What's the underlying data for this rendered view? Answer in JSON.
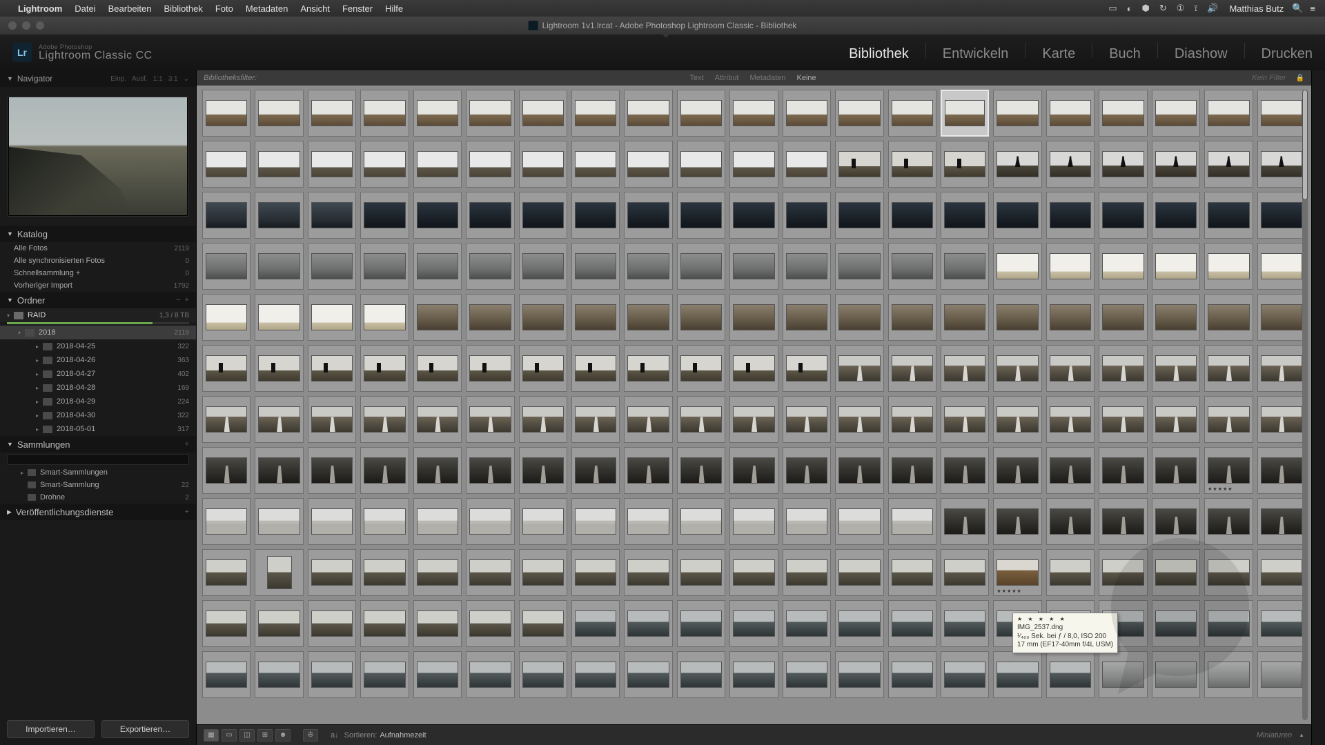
{
  "menubar": {
    "app": "Lightroom",
    "items": [
      "Datei",
      "Bearbeiten",
      "Bibliothek",
      "Foto",
      "Metadaten",
      "Ansicht",
      "Fenster",
      "Hilfe"
    ],
    "user": "Matthias Butz"
  },
  "window": {
    "title": "Lightroom 1v1.lrcat - Adobe Photoshop Lightroom Classic - Bibliothek"
  },
  "brand": {
    "small": "Adobe Photoshop",
    "big": "Lightroom Classic CC",
    "logo": "Lr"
  },
  "modules": {
    "items": [
      "Bibliothek",
      "Entwickeln",
      "Karte",
      "Buch",
      "Diashow",
      "Drucken"
    ],
    "active": 0
  },
  "navigator": {
    "title": "Navigator",
    "fit": "Einp.",
    "fill": "Ausf.",
    "r1": "1:1",
    "r2": "3:1"
  },
  "catalog": {
    "title": "Katalog",
    "rows": [
      {
        "label": "Alle Fotos",
        "count": "2119"
      },
      {
        "label": "Alle synchronisierten Fotos",
        "count": "0"
      },
      {
        "label": "Schnellsammlung  +",
        "count": "0"
      },
      {
        "label": "Vorheriger Import",
        "count": "1792"
      }
    ]
  },
  "folders": {
    "title": "Ordner",
    "volume": {
      "name": "RAID",
      "free": "1,3 / 8 TB"
    },
    "year": {
      "name": "2018",
      "count": "2119"
    },
    "dates": [
      {
        "name": "2018-04-25",
        "count": "322"
      },
      {
        "name": "2018-04-26",
        "count": "363"
      },
      {
        "name": "2018-04-27",
        "count": "402"
      },
      {
        "name": "2018-04-28",
        "count": "169"
      },
      {
        "name": "2018-04-29",
        "count": "224"
      },
      {
        "name": "2018-04-30",
        "count": "322"
      },
      {
        "name": "2018-05-01",
        "count": "317"
      }
    ]
  },
  "collections": {
    "title": "Sammlungen",
    "rows": [
      {
        "label": "Smart-Sammlungen",
        "count": ""
      },
      {
        "label": "Smart-Sammlung",
        "count": "22"
      },
      {
        "label": "Drohne",
        "count": "2"
      }
    ]
  },
  "publish": {
    "title": "Veröffentlichungsdienste"
  },
  "buttons": {
    "import": "Importieren…",
    "export": "Exportieren…"
  },
  "filterbar": {
    "label": "Bibliotheksfilter:",
    "tabs": [
      "Text",
      "Attribut",
      "Metadaten"
    ],
    "none": "Keine",
    "right": "Kein Filter"
  },
  "toolbar": {
    "sort_label": "Sortieren:",
    "sort_value": "Aufnahmezeit",
    "right": "Miniaturen"
  },
  "tooltip": {
    "stars": "★ ★ ★ ★ ★",
    "file": "IMG_2537.dng",
    "line2": "¹⁄₄₀₀ Sek. bei ƒ / 8,0, ISO 200",
    "line3": "17 mm (EF17-40mm f/4L USM)"
  },
  "grid_rows": [
    {
      "type": "land1",
      "count": 21,
      "sel": 15
    },
    {
      "type": "sky",
      "count": 21,
      "persons": [
        16,
        17,
        18,
        19,
        20,
        21
      ],
      "p2": [
        13,
        14,
        15
      ]
    },
    {
      "type": "dark",
      "count": 21
    },
    {
      "type": "hazy",
      "count": 21,
      "bright_from": 16
    },
    {
      "type": "rock",
      "count": 21,
      "bright_first": 4
    },
    {
      "type": "walker",
      "count": 21,
      "stream_from": 13
    },
    {
      "type": "stream",
      "count": 21
    },
    {
      "type": "streamdk",
      "count": 21,
      "stars_at": 20
    },
    {
      "type": "water",
      "count": 21,
      "dark_from": 15
    },
    {
      "type": "mtn",
      "count": 21,
      "port": 2,
      "brown": 16,
      "stars_at": 16
    },
    {
      "type": "mtn",
      "count": 21,
      "shore_from": 8
    },
    {
      "type": "shore",
      "count": 21,
      "mist_from": 18
    }
  ]
}
